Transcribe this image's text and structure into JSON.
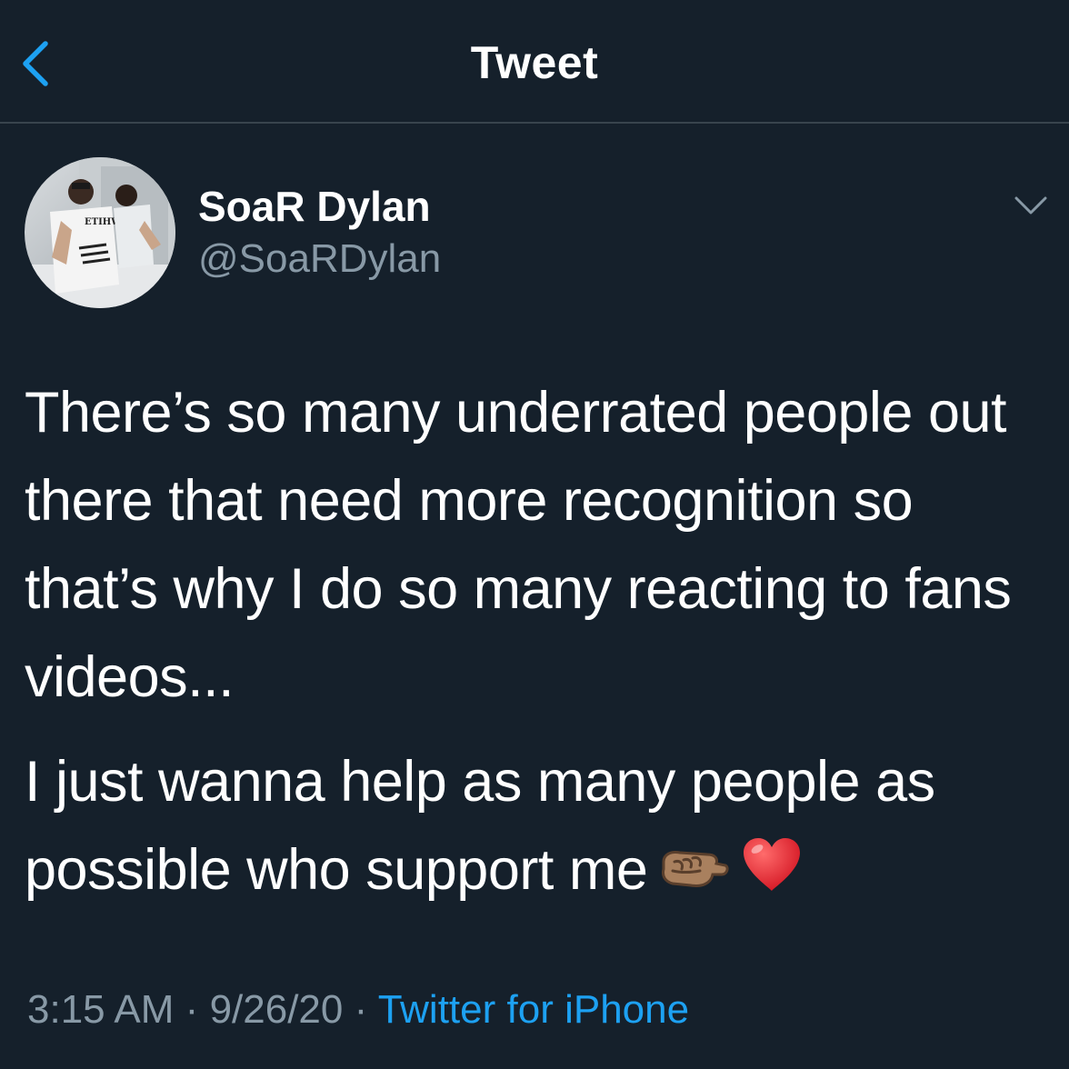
{
  "header": {
    "title": "Tweet",
    "back_icon": "chevron-left-icon",
    "accent_color": "#1da1f2"
  },
  "tweet": {
    "author": {
      "display_name": "SoaR Dylan",
      "handle": "@SoaRDylan",
      "avatar_shirt_text": "ETIHW"
    },
    "more_icon": "chevron-down-icon",
    "paragraph_1": "There’s so many underrated people out there that need more recognition so that’s why I do so many reacting to fans videos...",
    "paragraph_2": "I just wanna help as many people as possible who support me",
    "emojis": [
      "right-facing-fist-medium-skin-tone",
      "red-heart"
    ],
    "time": "3:15 AM",
    "separator": "·",
    "date": "9/26/20",
    "source": "Twitter for iPhone"
  },
  "colors": {
    "background": "#15202b",
    "text": "#ffffff",
    "secondary_text": "#8899a6",
    "divider": "#38444d"
  }
}
